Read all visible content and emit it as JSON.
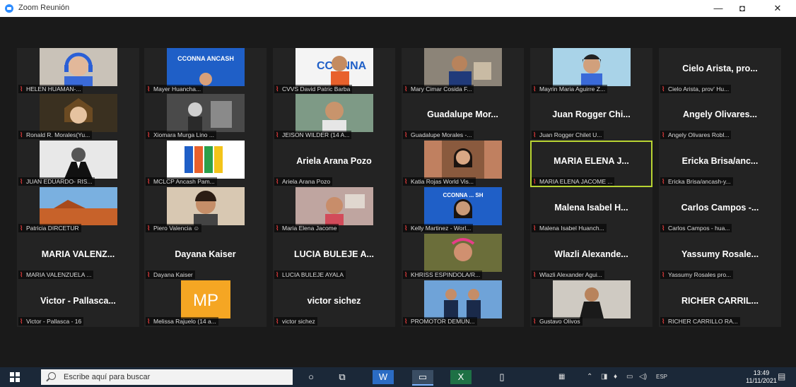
{
  "window": {
    "title": "Zoom Reunión",
    "minimize": "—",
    "maximize": "◘",
    "close": "✕"
  },
  "colors": {
    "active_speaker_border": "#b8d432",
    "muted_icon": "#e03b3b",
    "gallery_bg": "#1a1a1a",
    "tile_bg": "#232323"
  },
  "participants": [
    {
      "display": "",
      "label": "HELEN HUAMAN-...",
      "video": "person-blue-headphones"
    },
    {
      "display": "",
      "label": "Mayer Huancha...",
      "video": "ccoonna-banner",
      "banner": "CCONNA ANCASH"
    },
    {
      "display": "",
      "label": "CVVS David Patric Barba",
      "video": "ccoonna-logo-boy",
      "banner": "CCONNA"
    },
    {
      "display": "",
      "label": "Mary Cimar Cosida F...",
      "video": "boy-room"
    },
    {
      "display": "",
      "label": "Mayrin Maria Aguirre Z...",
      "video": "girl-blue"
    },
    {
      "display": "Cielo Arista, pro...",
      "label": "Cielo Arista, prov' Hu..."
    },
    {
      "display": "",
      "label": "Ronald R. Morales(Yu...",
      "video": "anime-avatar"
    },
    {
      "display": "",
      "label": "Xiomara Murga Lino ...",
      "video": "bw-photo"
    },
    {
      "display": "",
      "label": "JEISON WILDER (14 A...",
      "video": "boy-green"
    },
    {
      "display": "Guadalupe Mor...",
      "label": "Guadalupe Morales -..."
    },
    {
      "display": "Juan Rogger Chi...",
      "label": "Juan Rogger Chilet U..."
    },
    {
      "display": "Angely Olivares...",
      "label": "Angely Olivares Robl..."
    },
    {
      "display": "",
      "label": "JUAN EDUARDO- RIS...",
      "video": "bw-suit"
    },
    {
      "display": "",
      "label": "MCLCP Ancash Pam...",
      "video": "mclcp-logo"
    },
    {
      "display": "Ariela Arana Pozo",
      "label": "Ariela Arana Pozo"
    },
    {
      "display": "",
      "label": "Katia Rojas World Vis...",
      "video": "girl-curtains"
    },
    {
      "display": "MARIA ELENA J...",
      "label": "MARIA ELENA JACOME ...",
      "active": true
    },
    {
      "display": "Ericka Brisa/anc...",
      "label": "Ericka Brisa/ancash-y..."
    },
    {
      "display": "",
      "label": "Patricia DIRCETUR",
      "video": "landscape"
    },
    {
      "display": "",
      "label": "Piero Valencia ☺",
      "video": "boy-face"
    },
    {
      "display": "",
      "label": "Maria Elena Jacome",
      "video": "girl-room"
    },
    {
      "display": "",
      "label": "Kelly Martinez - Worl...",
      "video": "ccoonna-girl",
      "banner": "CCONNA ... SH"
    },
    {
      "display": "Malena Isabel H...",
      "label": "Malena Isabel Huanch..."
    },
    {
      "display": "Carlos Campos -...",
      "label": "Carlos Campos - hua..."
    },
    {
      "display": "MARIA VALENZ...",
      "label": "MARIA VALENZUELA ..."
    },
    {
      "display": "Dayana Kaiser",
      "label": "Dayana Kaiser"
    },
    {
      "display": "LUCIA BULEJE A...",
      "label": "LUCIA BULEJE AYALA"
    },
    {
      "display": "",
      "label": "KHRISS ESPINDOLA/R...",
      "video": "colorful"
    },
    {
      "display": "Wlazli Alexande...",
      "label": "Wlazli Alexander Agui..."
    },
    {
      "display": "Yassumy Rosale...",
      "label": "Yassumy Rosales pro..."
    },
    {
      "display": "Victor - Pallasca...",
      "label": "Victor - Pallasca - 16"
    },
    {
      "display": "",
      "label": "Melissa Rajuelo (14 a...",
      "video": "mp-initials",
      "initials": "MP"
    },
    {
      "display": "victor sichez",
      "label": "victor sichez"
    },
    {
      "display": "",
      "label": "PROMOTOR DEMUN...",
      "video": "group-photo"
    },
    {
      "display": "",
      "label": "Gustavo Olivos",
      "video": "man-suit"
    },
    {
      "display": "RICHER CARRIL...",
      "label": "RICHER CARRILLO RA..."
    }
  ],
  "taskbar": {
    "search_placeholder": "Escribe aquí para buscar",
    "language": "ESP",
    "time": "13:49",
    "date": "11/11/2021"
  }
}
